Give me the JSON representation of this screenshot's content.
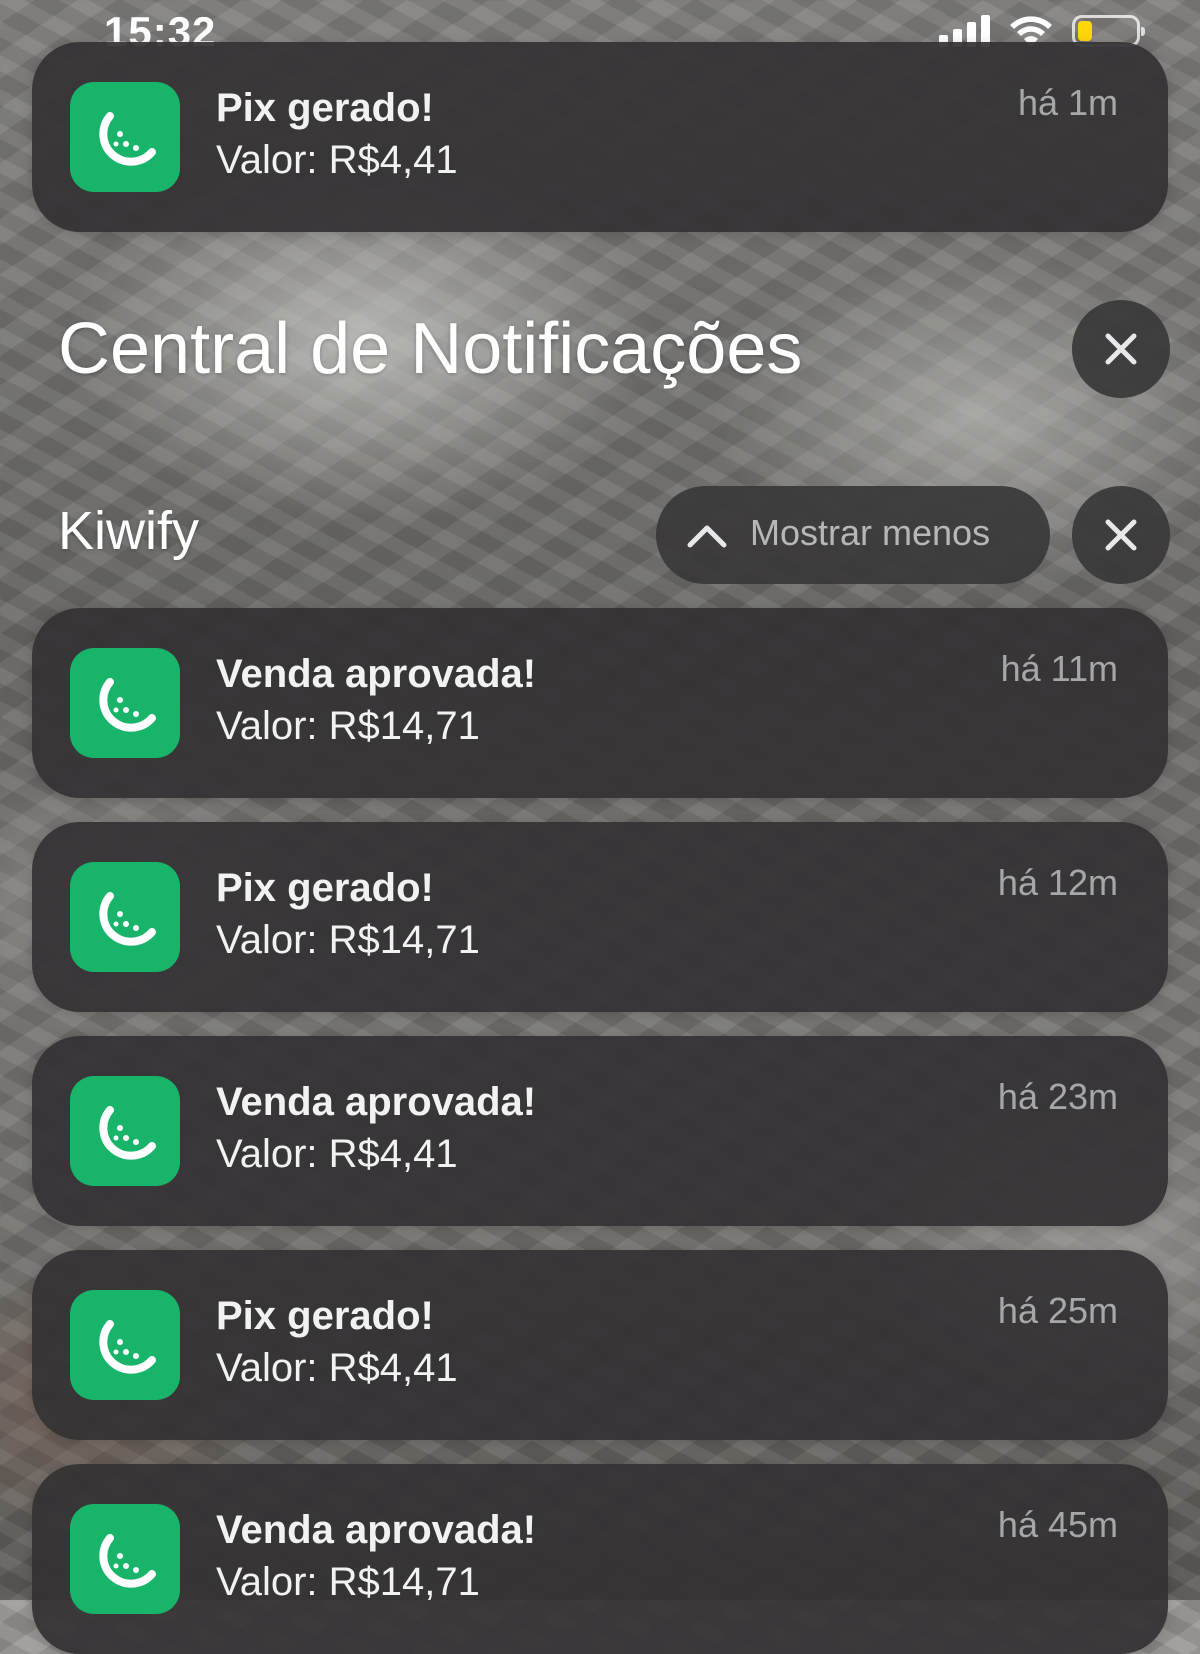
{
  "status_bar": {
    "time": "15:32",
    "battery_level": 0.25,
    "icons": [
      "signal-icon",
      "wifi-icon",
      "battery-icon"
    ]
  },
  "top_notification": {
    "title": "Pix gerado!",
    "body": "Valor: R$4,41",
    "time": "há 1m",
    "icon": "kiwify-app-icon"
  },
  "notification_center": {
    "title": "Central de Notificações",
    "clear_all_icon": "close-icon"
  },
  "app_group": {
    "app_name": "Kiwify",
    "show_less_label": "Mostrar menos",
    "collapse_icon": "chevron-up-icon",
    "clear_group_icon": "close-icon"
  },
  "notifications": [
    {
      "title": "Venda aprovada!",
      "body": "Valor: R$14,71",
      "time": "há 11m"
    },
    {
      "title": "Pix gerado!",
      "body": "Valor: R$14,71",
      "time": "há 12m"
    },
    {
      "title": "Venda aprovada!",
      "body": "Valor: R$4,41",
      "time": "há 23m"
    },
    {
      "title": "Pix gerado!",
      "body": "Valor: R$4,41",
      "time": "há 25m"
    },
    {
      "title": "Venda aprovada!",
      "body": "Valor: R$14,71",
      "time": "há 45m"
    }
  ],
  "colors": {
    "app_icon_green": "#17b46a",
    "card_background": "#343234",
    "battery_fill": "#ffd60a"
  }
}
